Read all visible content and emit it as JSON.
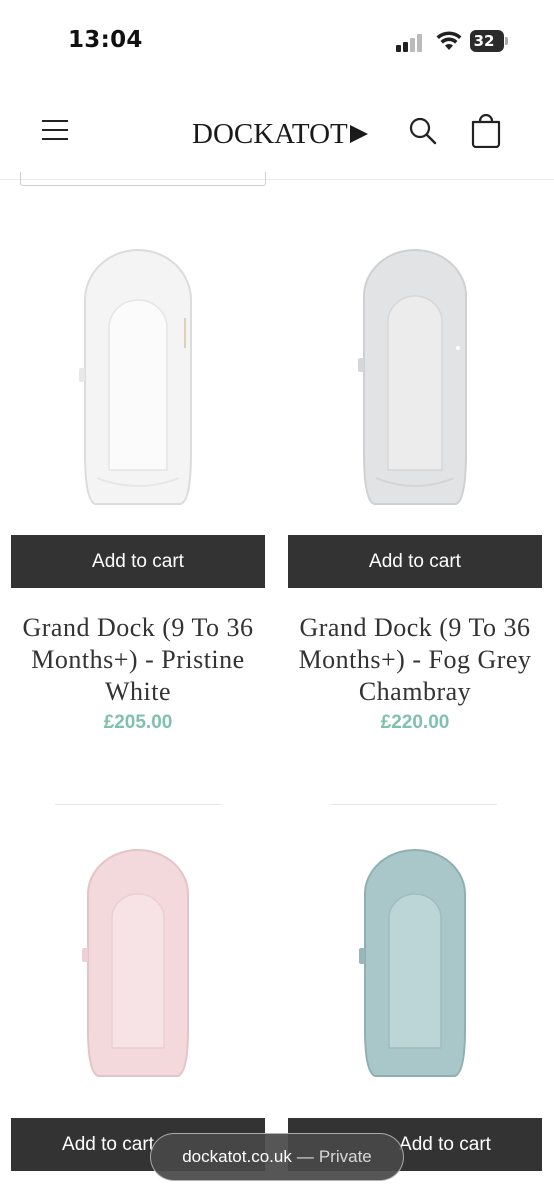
{
  "status_bar": {
    "time": "13:04",
    "battery": "32",
    "icons": [
      "signal-icon",
      "wifi-icon",
      "battery-icon"
    ]
  },
  "header": {
    "logo_text": "DOCKATOT",
    "menu_icon": "hamburger-menu-icon",
    "search_icon": "search-icon",
    "cart_icon": "cart-icon"
  },
  "products": [
    {
      "button_label": "Add to cart",
      "title": "Grand Dock (9 To 36 Months+) - Pristine White",
      "price": "£205.00",
      "color": "#f4f4f4"
    },
    {
      "button_label": "Add to cart",
      "title": "Grand Dock (9 To 36 Months+) - Fog Grey Chambray",
      "price": "£220.00",
      "color": "#e2e3e4"
    },
    {
      "button_label": "Add to cart",
      "color": "#f3d9dc"
    },
    {
      "button_label": "Add to cart",
      "color": "#a9c7c9"
    }
  ],
  "url_bar": {
    "domain": "dockatot.co.uk",
    "separator": "—",
    "mode": "Private"
  },
  "colors": {
    "button_bg": "#333333",
    "price": "#7fc1ad"
  }
}
